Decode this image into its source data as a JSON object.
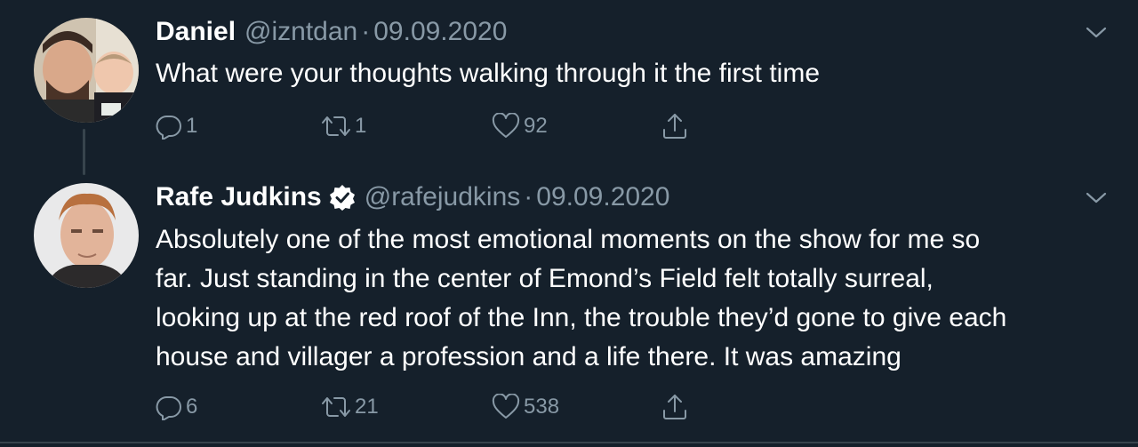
{
  "colors": {
    "background": "#15202b",
    "primary_text": "#ffffff",
    "secondary_text": "#8899a6",
    "divider": "#38444d"
  },
  "tweets": [
    {
      "author_name": "Daniel",
      "handle": "@izntdan",
      "separator": "·",
      "date": "09.09.2020",
      "verified": false,
      "text": "What were your thoughts walking through it the first time",
      "reply_count": "1",
      "retweet_count": "1",
      "like_count": "92",
      "icons": [
        "reply-icon",
        "retweet-icon",
        "like-icon",
        "share-icon",
        "chevron-down-icon"
      ]
    },
    {
      "author_name": "Rafe Judkins",
      "handle": "@rafejudkins",
      "separator": "·",
      "date": "09.09.2020",
      "verified": true,
      "text": "Absolutely one of the most emotional moments on the show for me so\nfar.  Just standing in the center of Emond’s Field felt totally surreal,\nlooking up at the red roof of the Inn, the trouble they’d gone to give each\nhouse and villager a profession and a life there. It was amazing",
      "reply_count": "6",
      "retweet_count": "21",
      "like_count": "538",
      "icons": [
        "reply-icon",
        "retweet-icon",
        "like-icon",
        "share-icon",
        "chevron-down-icon",
        "verified-badge-icon"
      ]
    }
  ]
}
